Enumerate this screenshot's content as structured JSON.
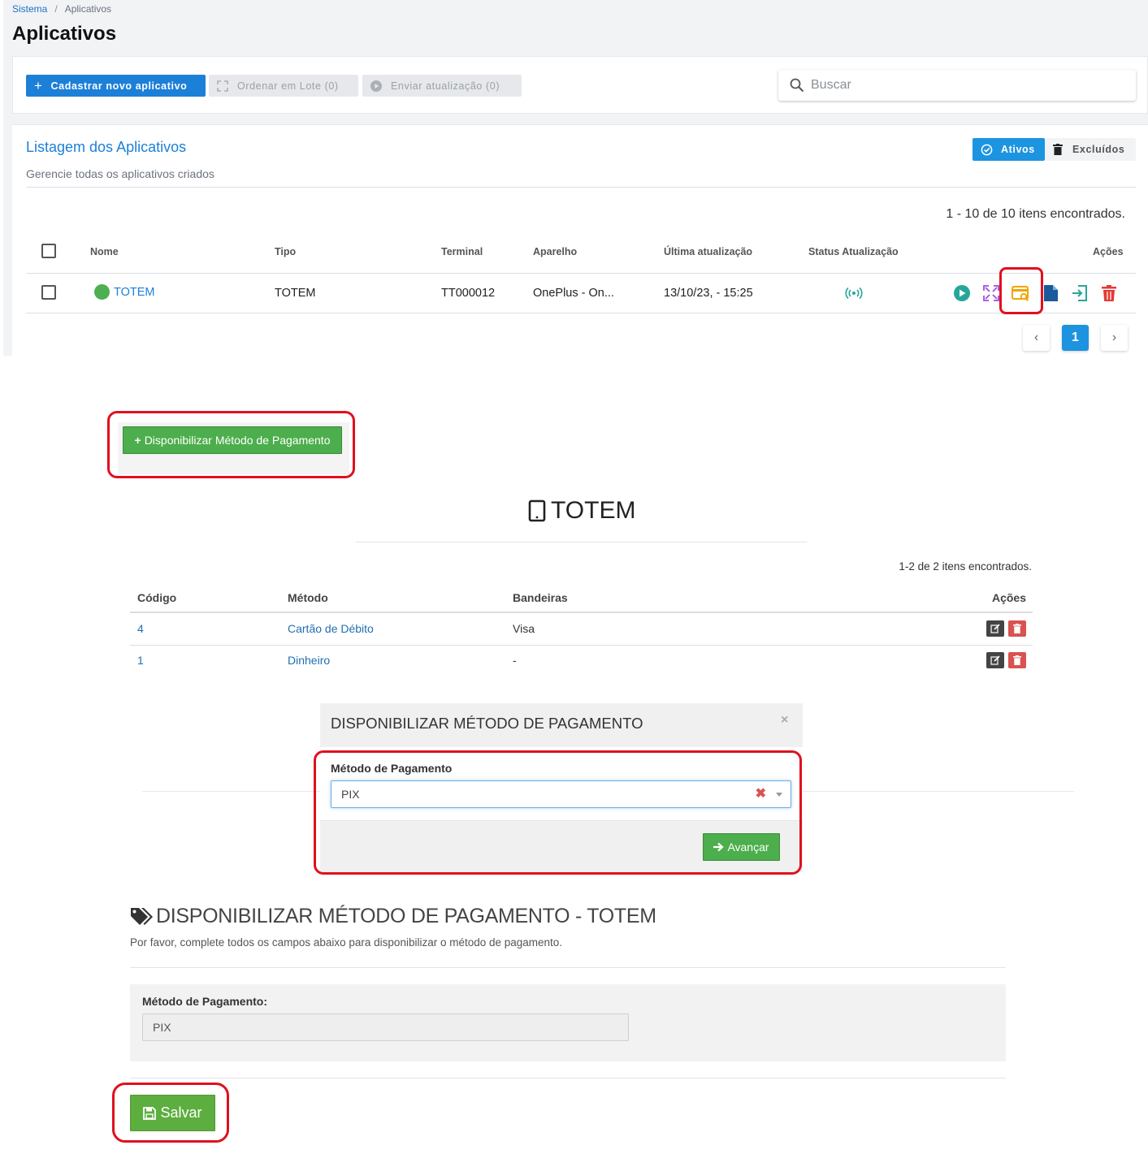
{
  "breadcrumb": {
    "root": "Sistema",
    "separator": "/",
    "current": "Aplicativos"
  },
  "page_title": "Aplicativos",
  "toolbar": {
    "new_app_label": "Cadastrar novo aplicativo",
    "batch_order_label": "Ordenar em Lote (0)",
    "send_update_label": "Enviar atualização (0)",
    "search_placeholder": "Buscar"
  },
  "listing": {
    "title": "Listagem dos Aplicativos",
    "subtitle": "Gerencie todas os aplicativos criados",
    "tabs": {
      "active": "Ativos",
      "deleted": "Excluídos"
    },
    "count_text": "1 - 10 de 10 itens encontrados.",
    "columns": [
      "Nome",
      "Tipo",
      "Terminal",
      "Aparelho",
      "Última atualização",
      "Status Atualização",
      "Ações"
    ],
    "rows": [
      {
        "name": "TOTEM",
        "type": "TOTEM",
        "terminal": "TT000012",
        "device": "OnePlus - On...",
        "last_update": "13/10/23, - 15:25"
      }
    ],
    "pagination": {
      "current_page": "1"
    }
  },
  "payment_section": {
    "add_button_label": "Disponibilizar Método de Pagamento",
    "device_title": "TOTEM",
    "count_text": "1-2 de 2 itens encontrados.",
    "columns": [
      "Código",
      "Método",
      "Bandeiras",
      "Ações"
    ],
    "rows": [
      {
        "code": "4",
        "method": "Cartão de Débito",
        "flags": "Visa"
      },
      {
        "code": "1",
        "method": "Dinheiro",
        "flags": "-"
      }
    ]
  },
  "modal": {
    "title": "DISPONIBILIZAR MÉTODO DE PAGAMENTO",
    "close_symbol": "×",
    "field_label": "Método de Pagamento",
    "selected_value": "PIX",
    "advance_label": "Avançar"
  },
  "form": {
    "title": "DISPONIBILIZAR MÉTODO DE PAGAMENTO - TOTEM",
    "subtitle": "Por favor, complete todos os campos abaixo para disponibilizar o método de pagamento.",
    "field_label": "Método de Pagamento:",
    "field_value": "PIX",
    "save_label": "Salvar"
  },
  "colors": {
    "primary_blue": "#1c7fd8",
    "tab_blue": "#1c94e0",
    "success_green": "#4cae4c",
    "highlight_red": "#e0101e",
    "status_online": "#4caf50"
  },
  "icons": {
    "new_app": "plus-icon",
    "batch_order": "expand-icon",
    "send_update": "play-circle-icon",
    "search": "search-icon",
    "tab_active": "check-circle-icon",
    "tab_deleted": "trash-icon",
    "status_update": "broadcast-icon",
    "row_actions": [
      "send-icon",
      "expand-icon",
      "payment-search-icon",
      "document-icon",
      "login-icon",
      "trash-icon"
    ],
    "device": "tablet-icon",
    "form_title": "tags-icon",
    "save": "floppy-icon",
    "advance": "arrow-right-icon"
  }
}
